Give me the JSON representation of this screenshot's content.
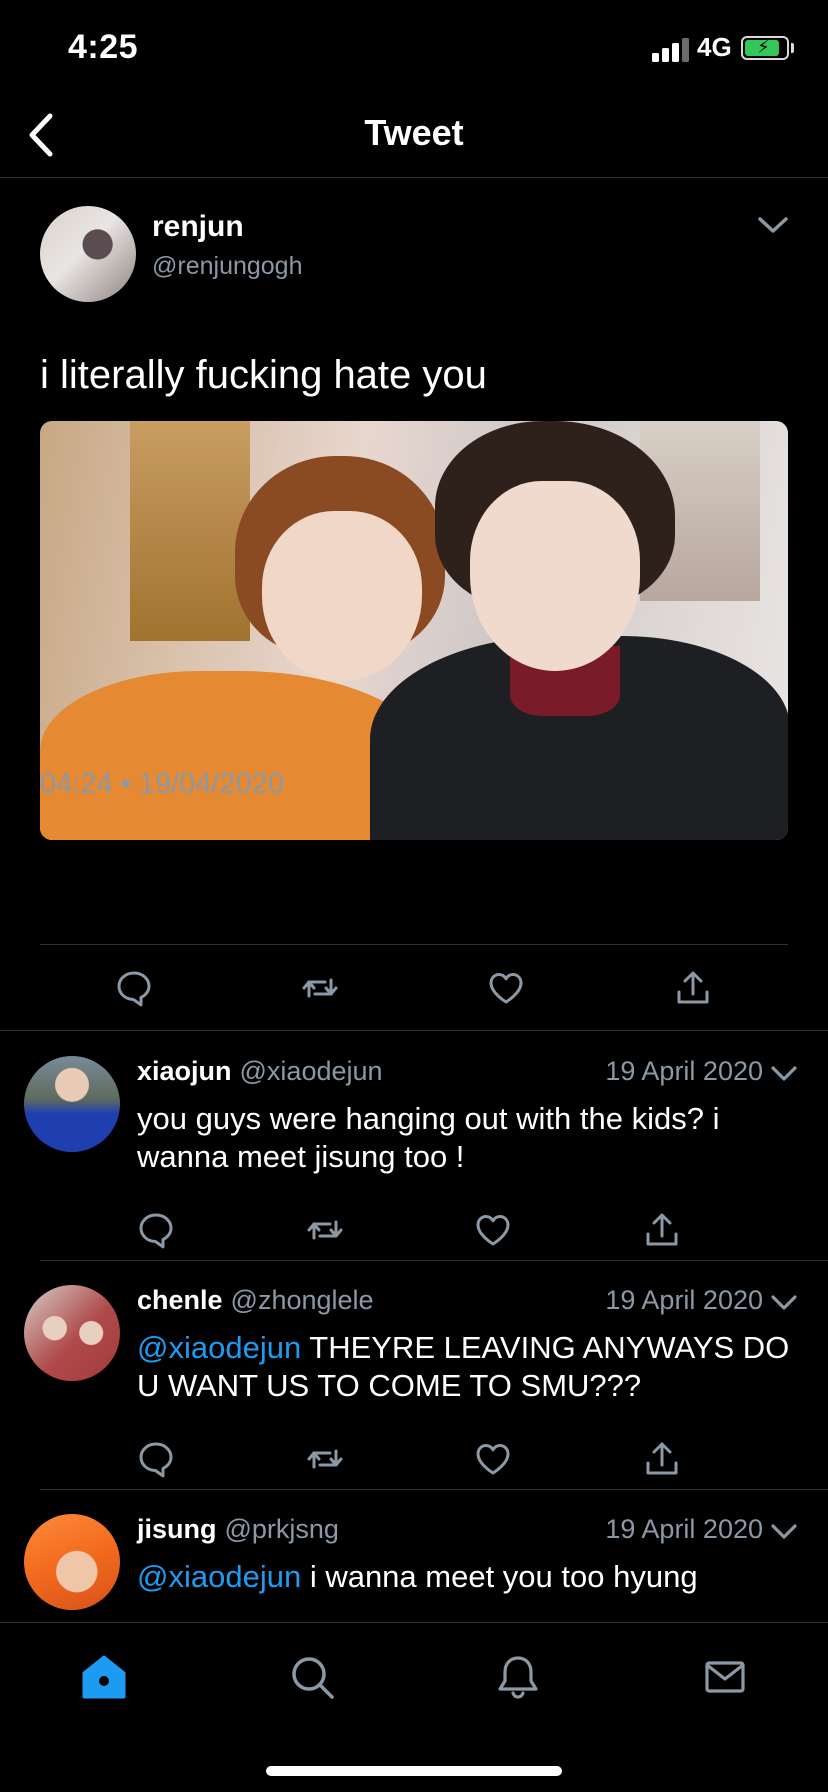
{
  "status_bar": {
    "time": "4:25",
    "network": "4G"
  },
  "nav": {
    "title": "Tweet"
  },
  "main_tweet": {
    "name": "renjun",
    "handle": "@renjungogh",
    "text": "i literally fucking hate you",
    "time": "04:24",
    "separator": " • ",
    "date": "19/04/2020"
  },
  "replies": [
    {
      "name": "xiaojun",
      "handle": "@xiaodejun",
      "date": "19 April 2020",
      "mention": "",
      "text": "you guys were hanging out with the kids? i wanna meet jisung too !"
    },
    {
      "name": "chenle",
      "handle": "@zhonglele",
      "date": "19 April 2020",
      "mention": "@xiaodejun",
      "text": " THEYRE LEAVING ANYWAYS DO U WANT US TO COME TO SMU???"
    },
    {
      "name": "jisung",
      "handle": "@prkjsng",
      "date": "19 April 2020",
      "mention": "@xiaodejun",
      "text": " i wanna meet you too hyung"
    }
  ],
  "colors": {
    "accent": "#1d9bf0",
    "muted": "#8b98a5",
    "divider": "#2f3336",
    "battery": "#33c759"
  },
  "icons": {
    "action_bar": [
      "reply-icon",
      "retweet-icon",
      "like-icon",
      "share-icon"
    ],
    "tab_bar": [
      "home-icon",
      "search-icon",
      "notifications-icon",
      "messages-icon"
    ]
  }
}
